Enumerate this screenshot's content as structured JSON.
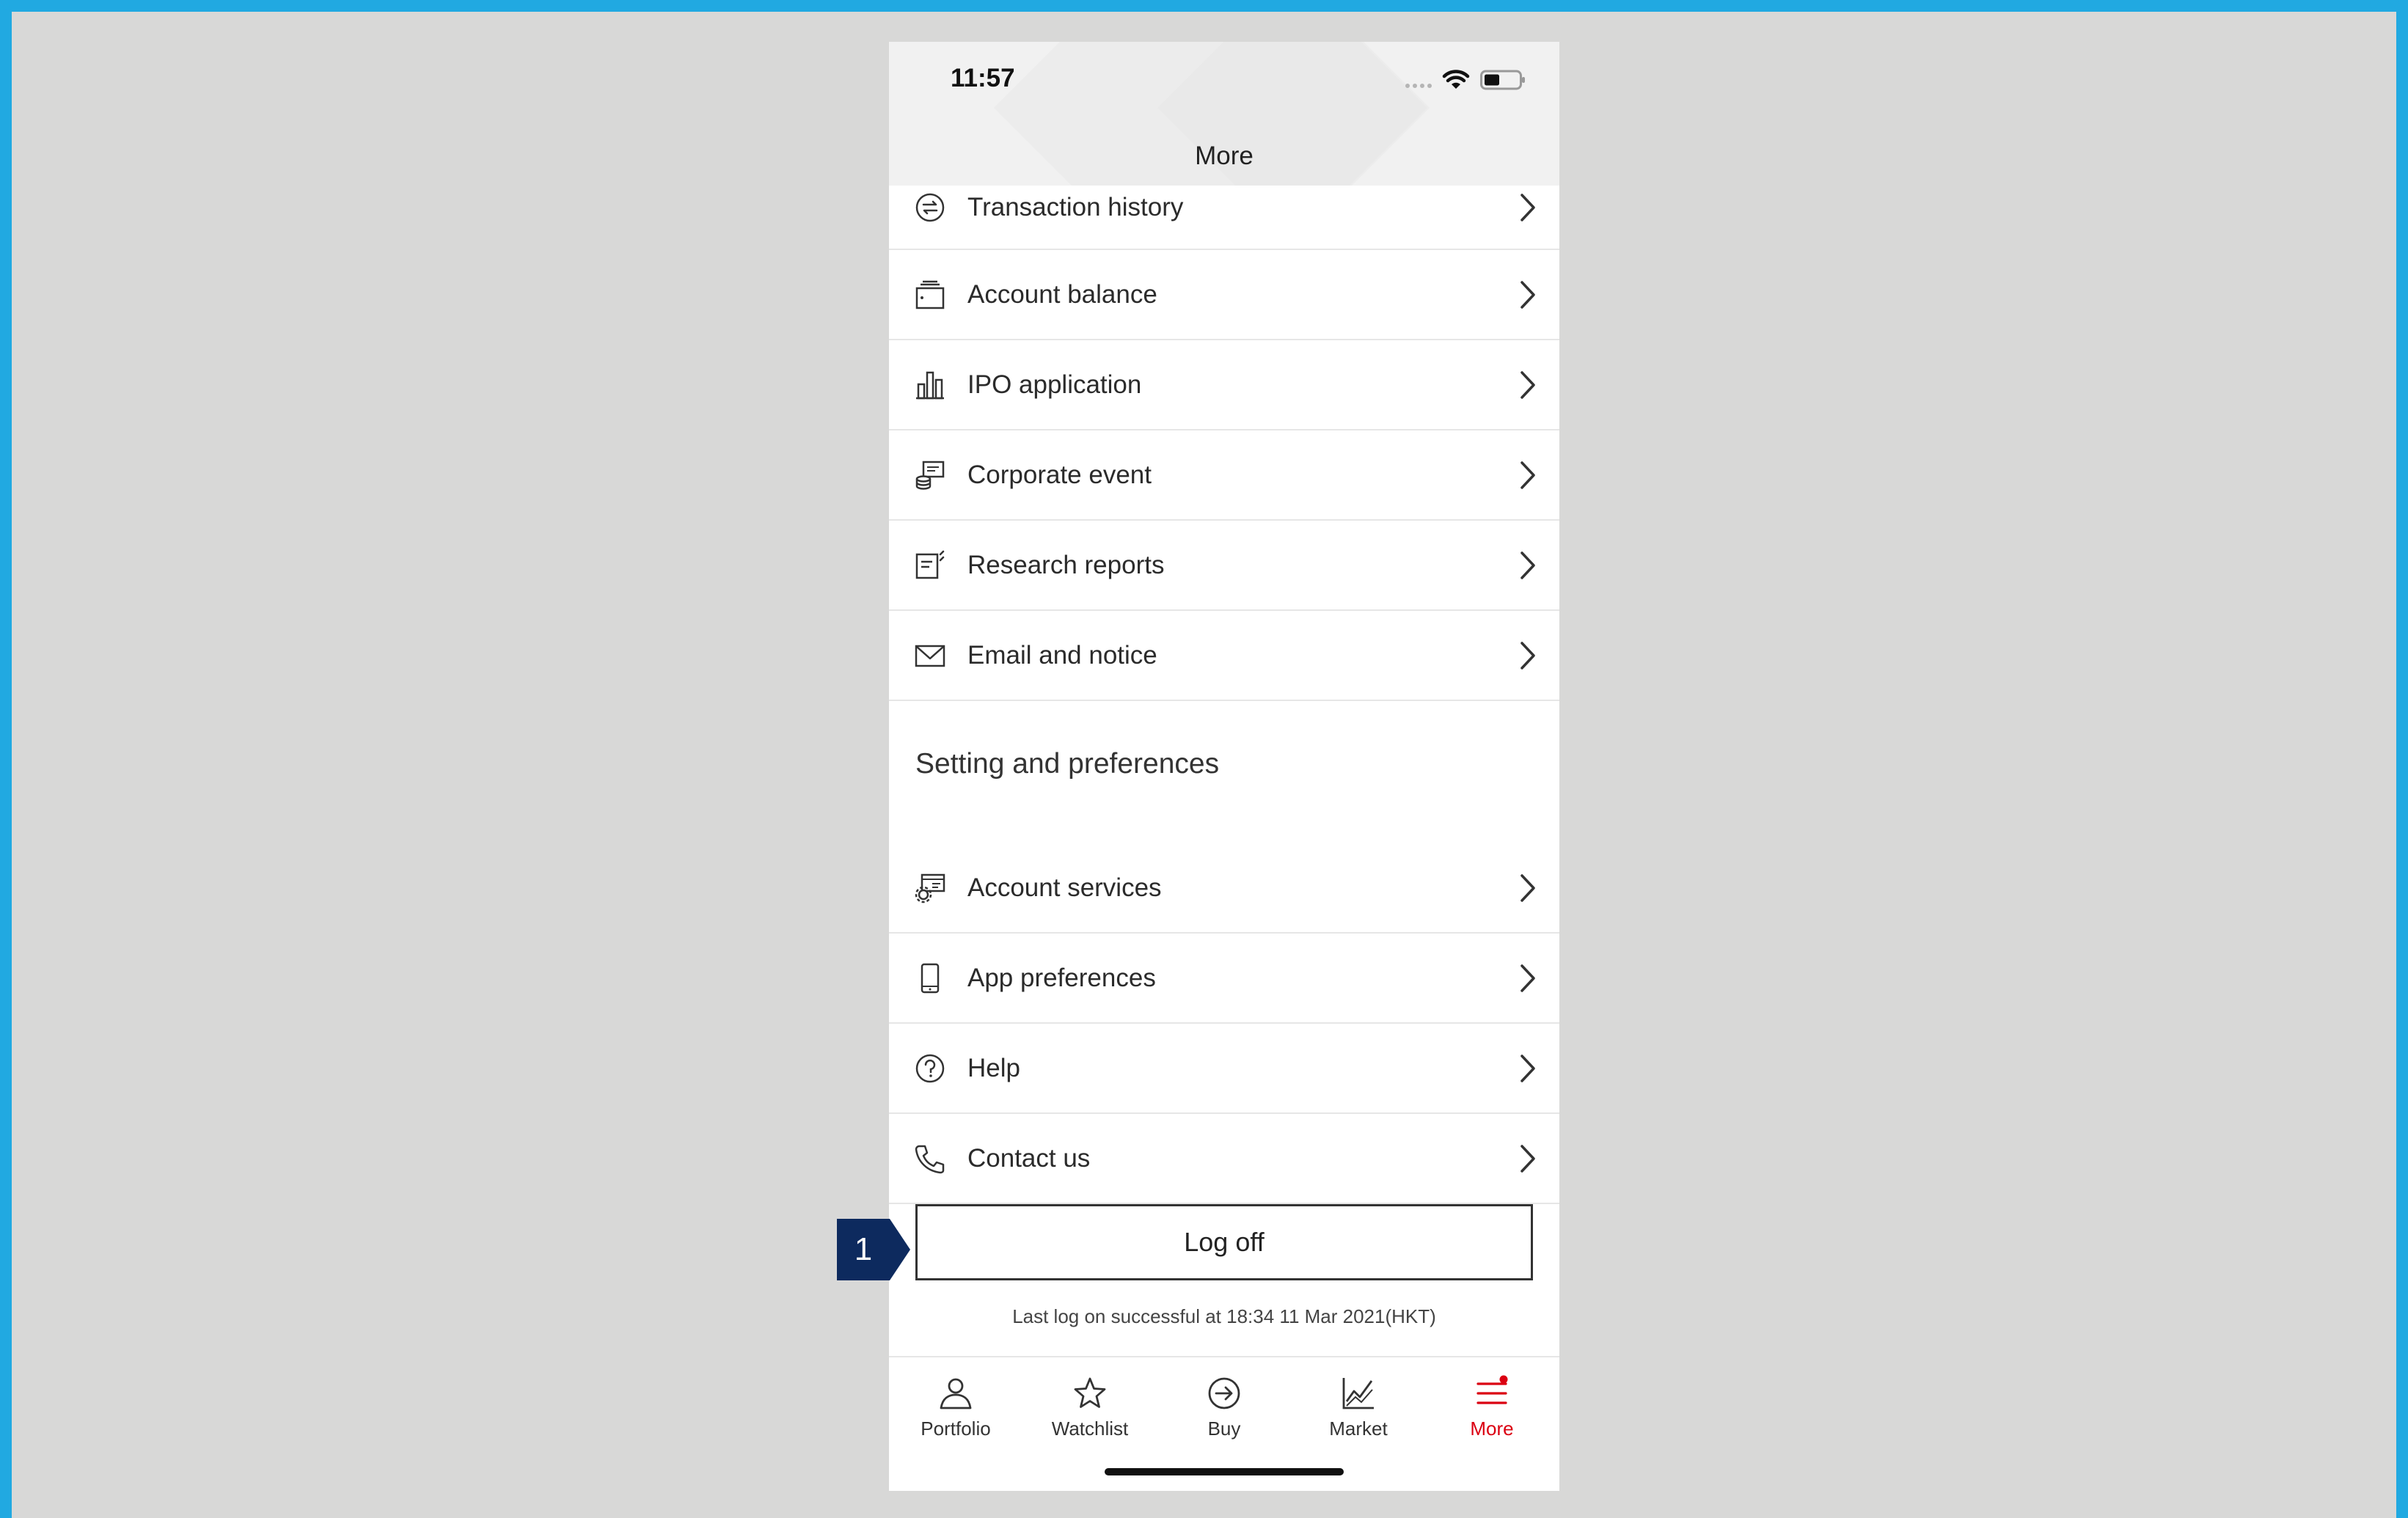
{
  "status_bar": {
    "time": "11:57"
  },
  "header": {
    "title": "More"
  },
  "menu_items": [
    {
      "label": "Transaction history",
      "icon": "transfer-icon"
    },
    {
      "label": "Account balance",
      "icon": "wallet-icon"
    },
    {
      "label": "IPO application",
      "icon": "bar-chart-icon"
    },
    {
      "label": "Corporate event",
      "icon": "coins-icon"
    },
    {
      "label": "Research reports",
      "icon": "report-icon"
    },
    {
      "label": "Email and notice",
      "icon": "envelope-icon"
    }
  ],
  "settings_section": {
    "title": "Setting and preferences",
    "items": [
      {
        "label": "Account services",
        "icon": "account-settings-icon"
      },
      {
        "label": "App preferences",
        "icon": "mobile-phone-icon"
      },
      {
        "label": "Help",
        "icon": "question-circle-icon"
      },
      {
        "label": "Contact us",
        "icon": "phone-icon"
      }
    ]
  },
  "logoff": {
    "label": "Log off",
    "last_log": "Last log on successful at 18:34 11 Mar 2021(HKT)"
  },
  "tabs": [
    {
      "label": "Portfolio",
      "icon": "user-icon",
      "active": false
    },
    {
      "label": "Watchlist",
      "icon": "star-icon",
      "active": false
    },
    {
      "label": "Buy",
      "icon": "arrow-circle-icon",
      "active": false
    },
    {
      "label": "Market",
      "icon": "line-chart-icon",
      "active": false
    },
    {
      "label": "More",
      "icon": "menu-icon",
      "active": true,
      "notification_dot": true
    }
  ],
  "callout": {
    "number": "1"
  },
  "colors": {
    "accent": "#db0011",
    "callout": "#0d2a5e",
    "frame": "#21a9e1",
    "background": "#d8d8d7"
  }
}
